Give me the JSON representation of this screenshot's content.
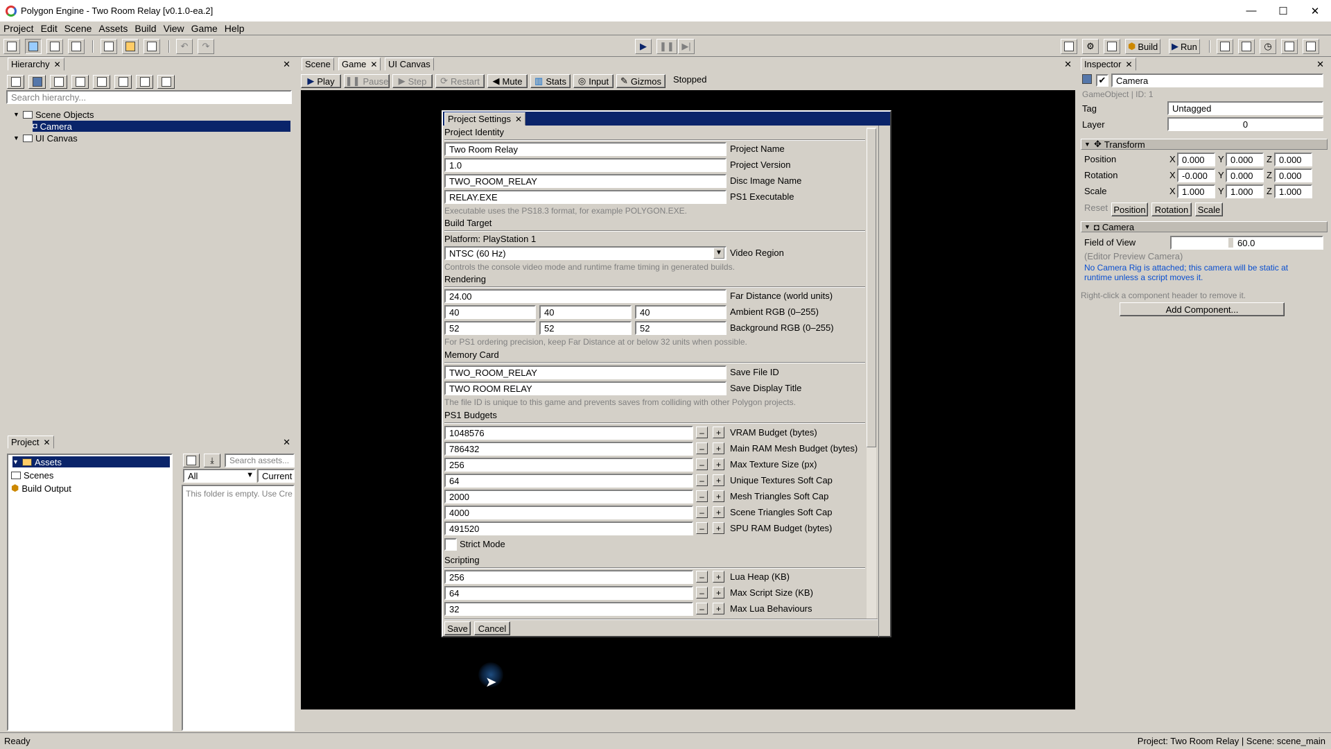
{
  "window": {
    "title": "Polygon Engine - Two Room Relay [v0.1.0-ea.2]",
    "minimize": "—",
    "maximize": "☐",
    "close": "✕"
  },
  "menu": [
    "Project",
    "Edit",
    "Scene",
    "Assets",
    "Build",
    "View",
    "Game",
    "Help"
  ],
  "toolbar": {
    "build_label": "Build",
    "run_label": "Run"
  },
  "hierarchy": {
    "tab": "Hierarchy",
    "search_placeholder": "Search hierarchy...",
    "items": [
      {
        "label": "Scene Objects"
      },
      {
        "label": "Camera"
      },
      {
        "label": "UI Canvas"
      }
    ]
  },
  "project_panel": {
    "tab": "Project",
    "tree": [
      "Assets",
      "Scenes",
      "Build Output"
    ],
    "search_placeholder": "Search assets...",
    "filter": "All",
    "scope": "Current f",
    "empty_text": "This folder is empty. Use Cre"
  },
  "center": {
    "tabs": [
      "Scene",
      "Game",
      "UI Canvas"
    ],
    "play": "Play",
    "pause": "Pause",
    "step": "Step",
    "restart": "Restart",
    "mute": "Mute",
    "stats": "Stats",
    "input": "Input",
    "gizmos": "Gizmos",
    "state": "Stopped"
  },
  "dialog": {
    "title": "Project Settings",
    "identity": {
      "header": "Project Identity",
      "name": "Two Room Relay",
      "name_label": "Project Name",
      "version": "1.0",
      "version_label": "Project Version",
      "disc": "TWO_ROOM_RELAY",
      "disc_label": "Disc Image Name",
      "exe": "RELAY.EXE",
      "exe_label": "PS1 Executable",
      "hint": "Executable uses the PS18.3 format, for example POLYGON.EXE."
    },
    "build": {
      "header": "Build Target",
      "platform": "Platform: PlayStation 1",
      "region": "NTSC (60 Hz)",
      "region_label": "Video Region",
      "hint": "Controls the console video mode and runtime frame timing in generated builds."
    },
    "rendering": {
      "header": "Rendering",
      "far": "24.00",
      "far_label": "Far Distance (world units)",
      "amb_r": "40",
      "amb_g": "40",
      "amb_b": "40",
      "amb_label": "Ambient RGB (0–255)",
      "bg_r": "52",
      "bg_g": "52",
      "bg_b": "52",
      "bg_label": "Background RGB (0–255)",
      "hint": "For PS1 ordering precision, keep Far Distance at or below 32 units when possible."
    },
    "memcard": {
      "header": "Memory Card",
      "file_id": "TWO_ROOM_RELAY",
      "file_id_label": "Save File ID",
      "display_title": "TWO ROOM RELAY",
      "display_title_label": "Save Display Title",
      "hint": "The file ID is unique to this game and prevents saves from colliding with other Polygon projects."
    },
    "budgets": {
      "header": "PS1 Budgets",
      "rows": [
        {
          "value": "1048576",
          "label": "VRAM Budget (bytes)"
        },
        {
          "value": "786432",
          "label": "Main RAM Mesh Budget (bytes)"
        },
        {
          "value": "256",
          "label": "Max Texture Size (px)"
        },
        {
          "value": "64",
          "label": "Unique Textures Soft Cap"
        },
        {
          "value": "2000",
          "label": "Mesh Triangles Soft Cap"
        },
        {
          "value": "4000",
          "label": "Scene Triangles Soft Cap"
        },
        {
          "value": "491520",
          "label": "SPU RAM Budget (bytes)"
        }
      ],
      "strict": "Strict Mode"
    },
    "scripting": {
      "header": "Scripting",
      "rows": [
        {
          "value": "256",
          "label": "Lua Heap (KB)"
        },
        {
          "value": "64",
          "label": "Max Script Size (KB)"
        },
        {
          "value": "32",
          "label": "Max Lua Behaviours"
        }
      ]
    },
    "save": "Save",
    "cancel": "Cancel",
    "minus": "–",
    "plus": "+"
  },
  "inspector": {
    "tab": "Inspector",
    "name": "Camera",
    "meta": "GameObject  |  ID: 1",
    "tag_label": "Tag",
    "tag": "Untagged",
    "layer_label": "Layer",
    "layer": "0",
    "transform": {
      "header": "Transform",
      "position_label": "Position",
      "rotation_label": "Rotation",
      "scale_label": "Scale",
      "pos": [
        "0.000",
        "0.000",
        "0.000"
      ],
      "rot": [
        "-0.000",
        "0.000",
        "0.000"
      ],
      "scl": [
        "1.000",
        "1.000",
        "1.000"
      ],
      "reset_label": "Reset",
      "reset_pos": "Position",
      "reset_rot": "Rotation",
      "reset_scale": "Scale"
    },
    "camera": {
      "header": "Camera",
      "fov_label": "Field of View",
      "fov": "60.0",
      "preview": "(Editor Preview Camera)",
      "warn1": "No Camera Rig is attached; this camera will be static at",
      "warn2": "runtime unless a script moves it."
    },
    "help": "Right-click a component header to remove it.",
    "add": "Add Component..."
  },
  "status": {
    "left": "Ready",
    "right": "Project: Two Room Relay  |  Scene: scene_main"
  },
  "colors": {
    "selection": "#0a246a",
    "warning": "#0a4fd0"
  }
}
